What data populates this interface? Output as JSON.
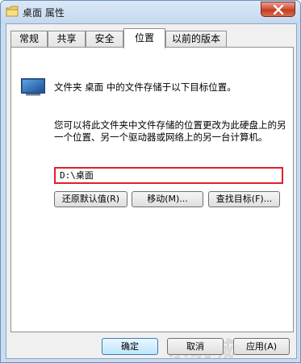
{
  "window": {
    "title": "桌面 属性"
  },
  "tabs": [
    {
      "label": "常规"
    },
    {
      "label": "共享"
    },
    {
      "label": "安全"
    },
    {
      "label": "位置",
      "active": true
    },
    {
      "label": "以前的版本"
    }
  ],
  "location": {
    "target_text": "文件夹 桌面 中的文件存储于以下目标位置。",
    "description": "您可以将此文件夹中文件存储的位置更改为此硬盘上的另一个位置、另一个驱动器或网络上的另一台计算机。",
    "path_value": "D:\\桌面",
    "restore_label": "还原默认值(R)",
    "move_label": "移动(M)...",
    "find_label": "查找目标(F)..."
  },
  "footer": {
    "ok_label": "确定",
    "cancel_label": "取消",
    "apply_label": "应用(A)"
  },
  "watermark": "系统城",
  "colors": {
    "highlight_border": "#e0202a",
    "close_button": "#c43c1f"
  },
  "icons": [
    "folder-icon",
    "close-icon",
    "monitor-folder-icon"
  ]
}
